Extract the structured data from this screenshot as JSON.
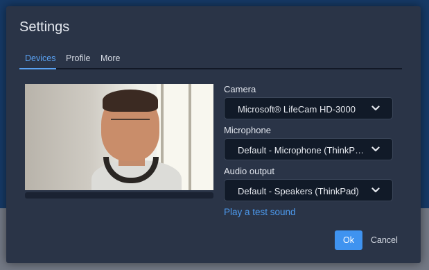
{
  "dialog": {
    "title": "Settings",
    "tabs": [
      {
        "label": "Devices",
        "active": true
      },
      {
        "label": "Profile",
        "active": false
      },
      {
        "label": "More",
        "active": false
      }
    ]
  },
  "devices": {
    "camera": {
      "label": "Camera",
      "value": "Microsoft® LifeCam HD-3000"
    },
    "microphone": {
      "label": "Microphone",
      "value": "Default - Microphone (ThinkPad)"
    },
    "audio_output": {
      "label": "Audio output",
      "value": "Default - Speakers (ThinkPad)"
    },
    "test_sound_link": "Play a test sound"
  },
  "actions": {
    "ok_label": "Ok",
    "cancel_label": "Cancel"
  },
  "colors": {
    "accent": "#3f93f0",
    "tab_active": "#5aa2f3",
    "modal_bg": "#2a3447",
    "select_bg": "#111a28",
    "link": "#4d9bf0"
  },
  "icons": {
    "select_chevron": "chevron-down-icon"
  }
}
